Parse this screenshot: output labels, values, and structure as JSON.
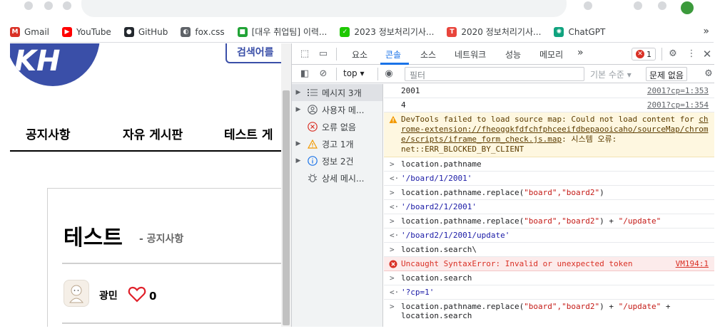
{
  "bookmarks": [
    {
      "label": "Gmail",
      "color": "#d93025",
      "glyph": "M"
    },
    {
      "label": "YouTube",
      "color": "#ff0000",
      "glyph": "▶"
    },
    {
      "label": "GitHub",
      "color": "#24292f",
      "glyph": "●"
    },
    {
      "label": "fox.css",
      "color": "#5f6368",
      "glyph": "◐"
    },
    {
      "label": "[대우 취업팀] 이력...",
      "color": "#21a336",
      "glyph": "■"
    },
    {
      "label": "2023 정보처리기사...",
      "color": "#1ec800",
      "glyph": "✓"
    },
    {
      "label": "2020 정보처리기사...",
      "color": "#e8453c",
      "glyph": "T"
    },
    {
      "label": "ChatGPT",
      "color": "#10a37f",
      "glyph": "✺"
    }
  ],
  "bookmarks_more": "»",
  "page": {
    "search_text": "검색어를",
    "nav": [
      "공지사항",
      "자유 게시판",
      "테스트 게"
    ],
    "post_title": "테스트",
    "post_category": "- 공지사항",
    "author": "광민",
    "likes": "0"
  },
  "devtools": {
    "tabs": [
      "요소",
      "콘솔",
      "소스",
      "네트워크",
      "성능",
      "메모리"
    ],
    "active_tab": "콘솔",
    "more_tabs": "»",
    "error_count": "1",
    "context": "top",
    "filter_placeholder": "필터",
    "level": "기본 수준",
    "issues": "문제 없음",
    "sidebar": [
      {
        "label": "메시지 3개",
        "icon": "list",
        "arrow": "▶",
        "selected": true
      },
      {
        "label": "사용자 메...",
        "icon": "user",
        "arrow": "▶",
        "selected": false
      },
      {
        "label": "오류 없음",
        "icon": "error",
        "arrow": "",
        "selected": false
      },
      {
        "label": "경고 1개",
        "icon": "warning",
        "arrow": "▶",
        "selected": false
      },
      {
        "label": "정보 2건",
        "icon": "info",
        "arrow": "▶",
        "selected": false
      },
      {
        "label": "상세 메시...",
        "icon": "bug",
        "arrow": "",
        "selected": false
      }
    ],
    "console": {
      "out1": {
        "text": "2001",
        "src": "2001?cp=1:353"
      },
      "out2": {
        "text": "4",
        "src": "2001?cp=1:354"
      },
      "warn": {
        "prefix": "DevTools failed to load source map: Could not load content for ",
        "link": "chrome-extension://fheoggkfdfchfphceeifdbepaooicaho/sourceMap/chrome/scripts/iframe_form_check.js.map",
        "suffix": ": 시스템 오류: net::ERR_BLOCKED_BY_CLIENT"
      },
      "cmd1": "location.pathname",
      "res1": "'/board/1/2001'",
      "cmd2a": "location.pathname.replace(",
      "cmd2s": "\"board\",\"board2\"",
      "cmd2b": ")",
      "res2": "'/board2/1/2001'",
      "cmd3a": "location.pathname.replace(",
      "cmd3s": "\"board\",\"board2\"",
      "cmd3b": ") + ",
      "cmd3c": "\"/update\"",
      "res3": "'/board2/1/2001/update'",
      "cmd4": "location.search\\",
      "err": {
        "text": "Uncaught SyntaxError: Invalid or unexpected token",
        "src": "VM194:1"
      },
      "cmd5": "location.search",
      "res5": "'?cp=1'",
      "cmd6a": "location.pathname.replace(",
      "cmd6s": "\"board\",\"board2\"",
      "cmd6b": ") + ",
      "cmd6c": "\"/update\"",
      "cmd6d": " +",
      "cmd6e": "location.search"
    }
  },
  "colors": {
    "accent": "#1a73e8",
    "brand": "#3a4fa8",
    "error": "#d93025",
    "warning_bg": "#fef7e0",
    "heart": "#e0202a"
  }
}
